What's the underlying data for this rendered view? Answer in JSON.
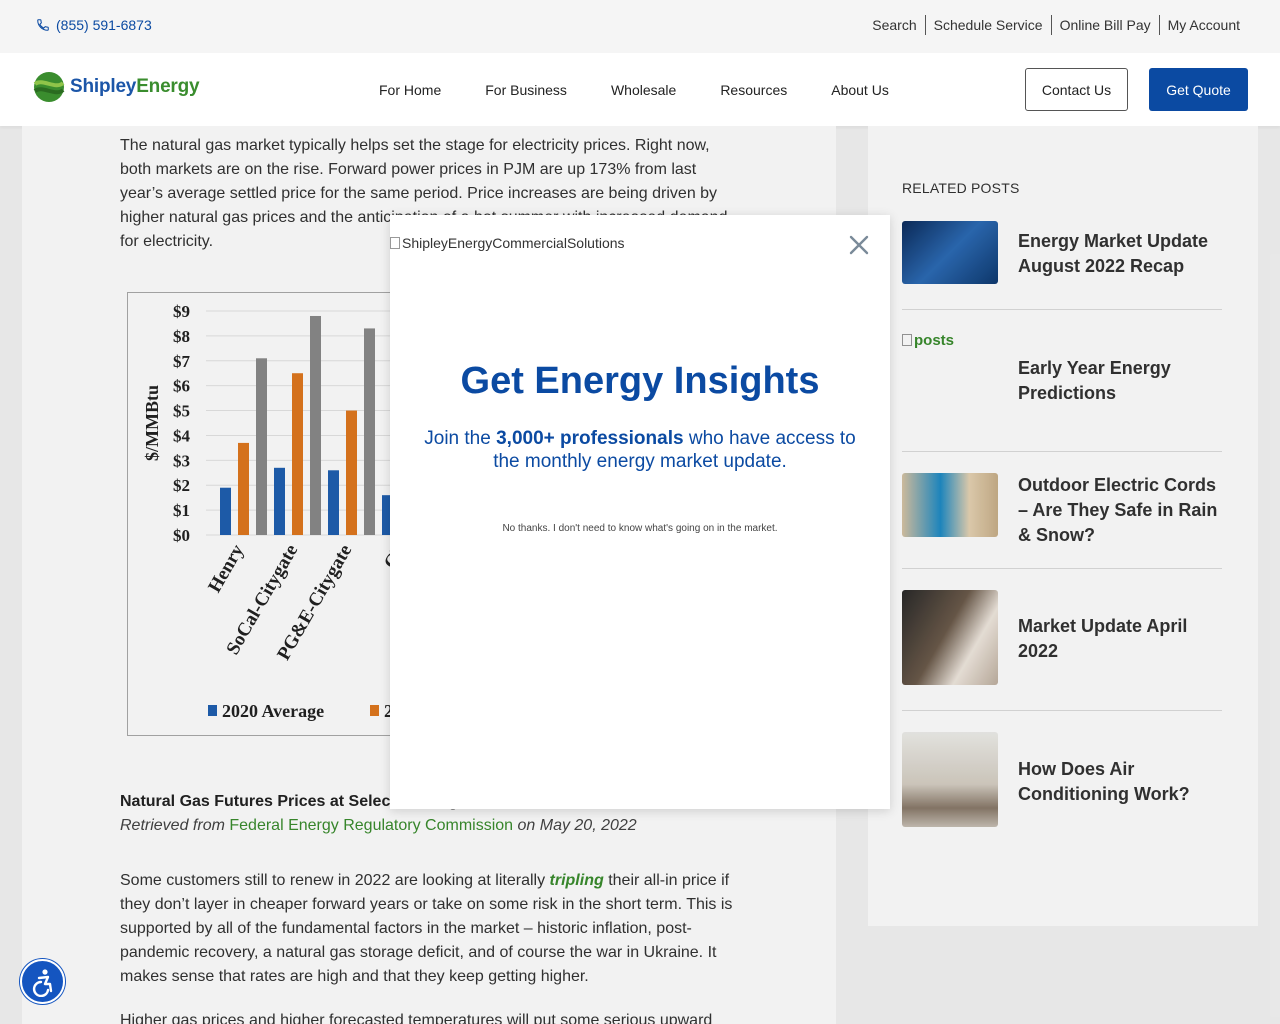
{
  "topbar": {
    "phone": "(855) 591-6873",
    "links": [
      "Search",
      "Schedule Service",
      "Online Bill Pay",
      "My Account"
    ]
  },
  "header": {
    "logo_word1": "Shipley",
    "logo_word2": "Energy",
    "nav": [
      "For Home",
      "For Business",
      "Wholesale",
      "Resources",
      "About Us"
    ],
    "contact_label": "Contact Us",
    "quote_label": "Get Quote"
  },
  "article": {
    "para1": "The natural gas market typically helps set the stage for electricity prices. Right now, both markets are on the rise. Forward power prices in PJM are up 173% from last year’s average settled price for the same period. Price increases are being driven by higher natural gas prices and the anticipation of a hot summer with increased demand for electricity.",
    "caption_title": "Natural Gas Futures Prices at Select Trading Hubs",
    "caption_src_prefix": "Retrieved from ",
    "caption_src_link": "Federal Energy Regulatory Commission",
    "caption_src_suffix": " on May 20, 2022",
    "para2_a": "Some customers still to renew in 2022 are looking at literally ",
    "para2_em": "tripling",
    "para2_b": " their all-in price if they don’t layer in cheaper forward years or take on some risk in the short term. This is supported by all of the fundamental factors in the market – historic inflation, post-pandemic recovery, a natural gas storage deficit, and of course the war in Ukraine. It makes sense that rates are high and that they keep getting higher.",
    "para3": "Higher gas prices and higher forecasted temperatures will put some serious upward"
  },
  "chart_data": {
    "type": "bar",
    "ylabel": "$/MMBtu",
    "ylim": [
      0,
      9
    ],
    "yticks": [
      "$0",
      "$1",
      "$2",
      "$3",
      "$4",
      "$5",
      "$6",
      "$7",
      "$8",
      "$9"
    ],
    "categories": [
      "Henry",
      "SoCal-Citygate",
      "PG&E-Citygate",
      "Ch"
    ],
    "series": [
      {
        "name": "2020 Average",
        "color": "#1f5fb0",
        "values": [
          1.9,
          2.7,
          2.6,
          1.6
        ]
      },
      {
        "name": "2",
        "color": "#e0781e",
        "values": [
          3.7,
          6.5,
          5.0,
          null
        ]
      },
      {
        "name": "",
        "color": "#8a8a8a",
        "values": [
          7.1,
          8.8,
          8.3,
          null
        ]
      }
    ]
  },
  "sidebar": {
    "related_header": "RELATED POSTS",
    "posts": [
      {
        "title": "Energy Market Update August 2022 Recap"
      },
      {
        "title": "Early Year Energy Predictions",
        "img_alt": "posts"
      },
      {
        "title": "Outdoor Electric Cords – Are They Safe in Rain & Snow?"
      },
      {
        "title": "Market Update April 2022"
      },
      {
        "title": "How Does Air Conditioning Work?"
      }
    ]
  },
  "modal": {
    "img_alt": "ShipleyEnergyCommercialSolutions",
    "title": "Get Energy Insights",
    "sub_a": "Join the ",
    "sub_b": "3,000+ professionals",
    "sub_c": " who have access to the monthly energy market update.",
    "decline": "No thanks. I don't need to know what's going on in the market."
  },
  "colors": {
    "brand_blue": "#0b4aa2",
    "brand_green": "#3a8d2e"
  }
}
